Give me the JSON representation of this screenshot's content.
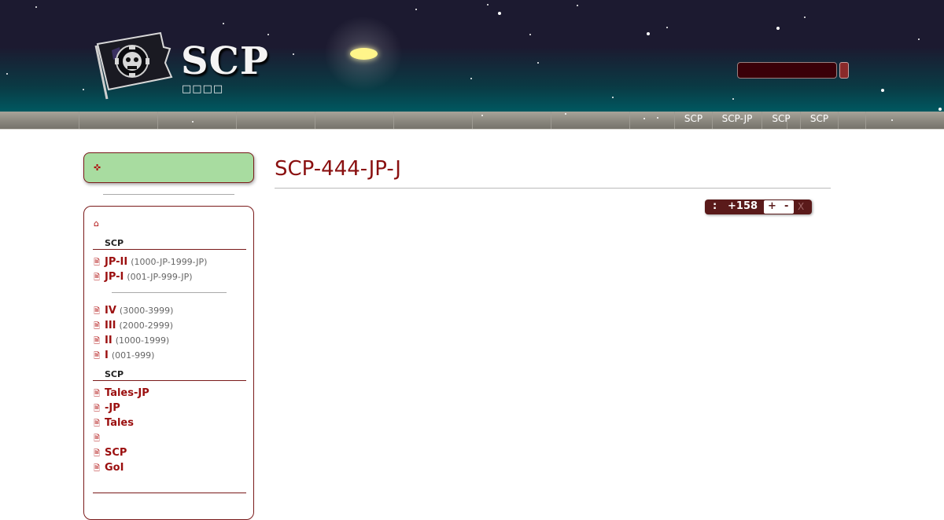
{
  "header": {
    "logo_text": "SCP",
    "logo_subtitle": "□□□□",
    "search": {
      "placeholder": ""
    }
  },
  "navbar": {
    "items": [
      "SCP",
      "SCP-JP",
      "SCP",
      "SCP"
    ]
  },
  "sidebar": {
    "top_box_icon": "plus-cross-icon",
    "home_icon": "home-icon",
    "sections": [
      {
        "heading": "SCP",
        "items": [
          {
            "label": "JP-II",
            "range": "(1000-JP-1999-JP)"
          },
          {
            "label": "JP-I",
            "range": "(001-JP-999-JP)"
          },
          {
            "label": "IV",
            "range": "(3000-3999)"
          },
          {
            "label": "III",
            "range": "(2000-2999)"
          },
          {
            "label": "II",
            "range": "(1000-1999)"
          },
          {
            "label": "I",
            "range": "(001-999)"
          }
        ]
      },
      {
        "heading": "SCP",
        "items": [
          {
            "label": "Tales-JP"
          },
          {
            "label": "-JP"
          },
          {
            "label": "Tales"
          },
          {
            "label": ""
          },
          {
            "label": "SCP"
          },
          {
            "label": "GoI"
          }
        ]
      }
    ]
  },
  "main": {
    "title": "SCP-444-JP-J",
    "rating": {
      "label": ":",
      "value": "+158",
      "plus": "+",
      "minus": "-",
      "close": "X"
    }
  },
  "colors": {
    "accent": "#8a1010",
    "link": "#9b0f0f",
    "sidebar_highlight": "#a8dca0",
    "rating_bg": "#5a1a1a"
  }
}
